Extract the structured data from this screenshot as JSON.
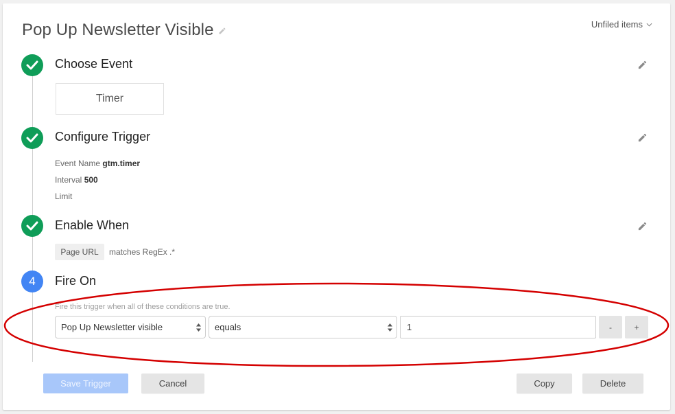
{
  "header": {
    "title": "Pop Up Newsletter Visible",
    "folder_label": "Unfiled items"
  },
  "steps": [
    {
      "status": "done",
      "title": "Choose Event",
      "event_type": "Timer"
    },
    {
      "status": "done",
      "title": "Configure Trigger",
      "details": [
        {
          "label": "Event Name",
          "value": "gtm.timer"
        },
        {
          "label": "Interval",
          "value": "500"
        },
        {
          "label": "Limit",
          "value": ""
        }
      ]
    },
    {
      "status": "done",
      "title": "Enable When",
      "condition": {
        "variable": "Page URL",
        "rest": "matches RegEx .*"
      }
    },
    {
      "status": "active",
      "number": "4",
      "title": "Fire On",
      "hint": "Fire this trigger when all of these conditions are true.",
      "condition": {
        "variable": "Pop Up Newsletter visible",
        "operator": "equals",
        "value": "1"
      },
      "remove_label": "-",
      "add_label": "+"
    }
  ],
  "footer": {
    "save_label": "Save Trigger",
    "cancel_label": "Cancel",
    "copy_label": "Copy",
    "delete_label": "Delete"
  },
  "colors": {
    "done": "#0f9d58",
    "active": "#4285f4",
    "save_disabled": "#a8c7fa",
    "annotation": "#d40000"
  }
}
